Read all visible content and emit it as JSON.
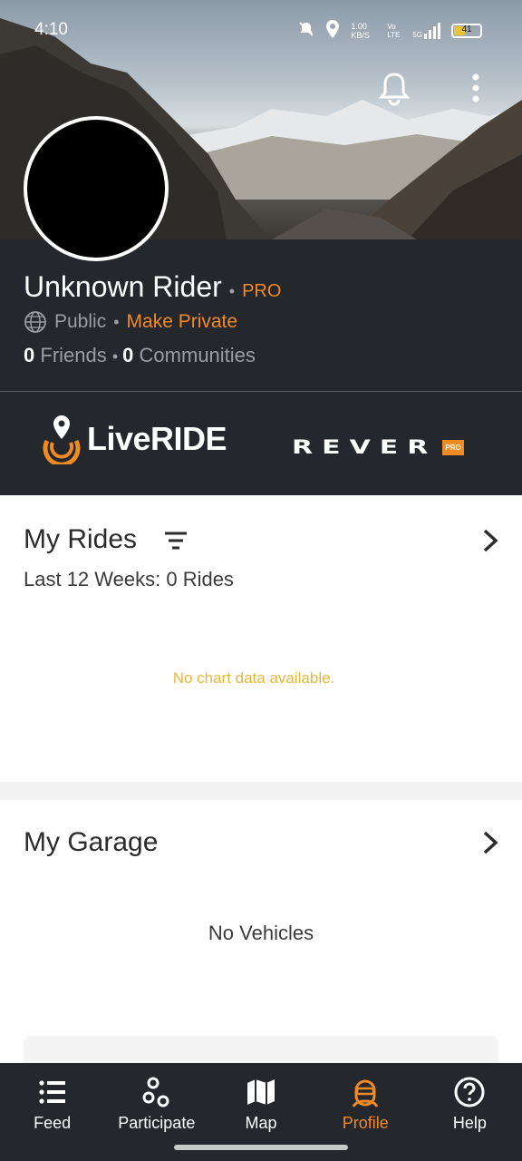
{
  "status_bar": {
    "time": "4:10",
    "network_speed": "1.00 KB/S",
    "volte": "Vo LTE",
    "network": "5G",
    "battery": "41"
  },
  "header": {
    "icons": [
      "bell-icon",
      "more-vert-icon"
    ]
  },
  "profile": {
    "name": "Unknown Rider",
    "badge": "PRO",
    "visibility": "Public",
    "make_private": "Make Private",
    "friends_count": "0",
    "friends_label": "Friends",
    "communities_count": "0",
    "communities_label": "Communities"
  },
  "brands": {
    "liveride": "LiveRIDE",
    "rever": "REVER",
    "rever_badge": "PRO"
  },
  "rides": {
    "title": "My Rides",
    "subtitle": "Last 12 Weeks: 0 Rides",
    "empty": "No chart data available."
  },
  "garage": {
    "title": "My Garage",
    "empty": "No Vehicles"
  },
  "nav": {
    "items": [
      {
        "label": "Feed",
        "icon": "feed-icon"
      },
      {
        "label": "Participate",
        "icon": "participate-icon"
      },
      {
        "label": "Map",
        "icon": "map-icon"
      },
      {
        "label": "Profile",
        "icon": "profile-icon",
        "active": true
      },
      {
        "label": "Help",
        "icon": "help-icon"
      }
    ]
  },
  "colors": {
    "accent": "#f08a24",
    "panel": "#24272b",
    "empty_chart": "#e8b73a"
  }
}
